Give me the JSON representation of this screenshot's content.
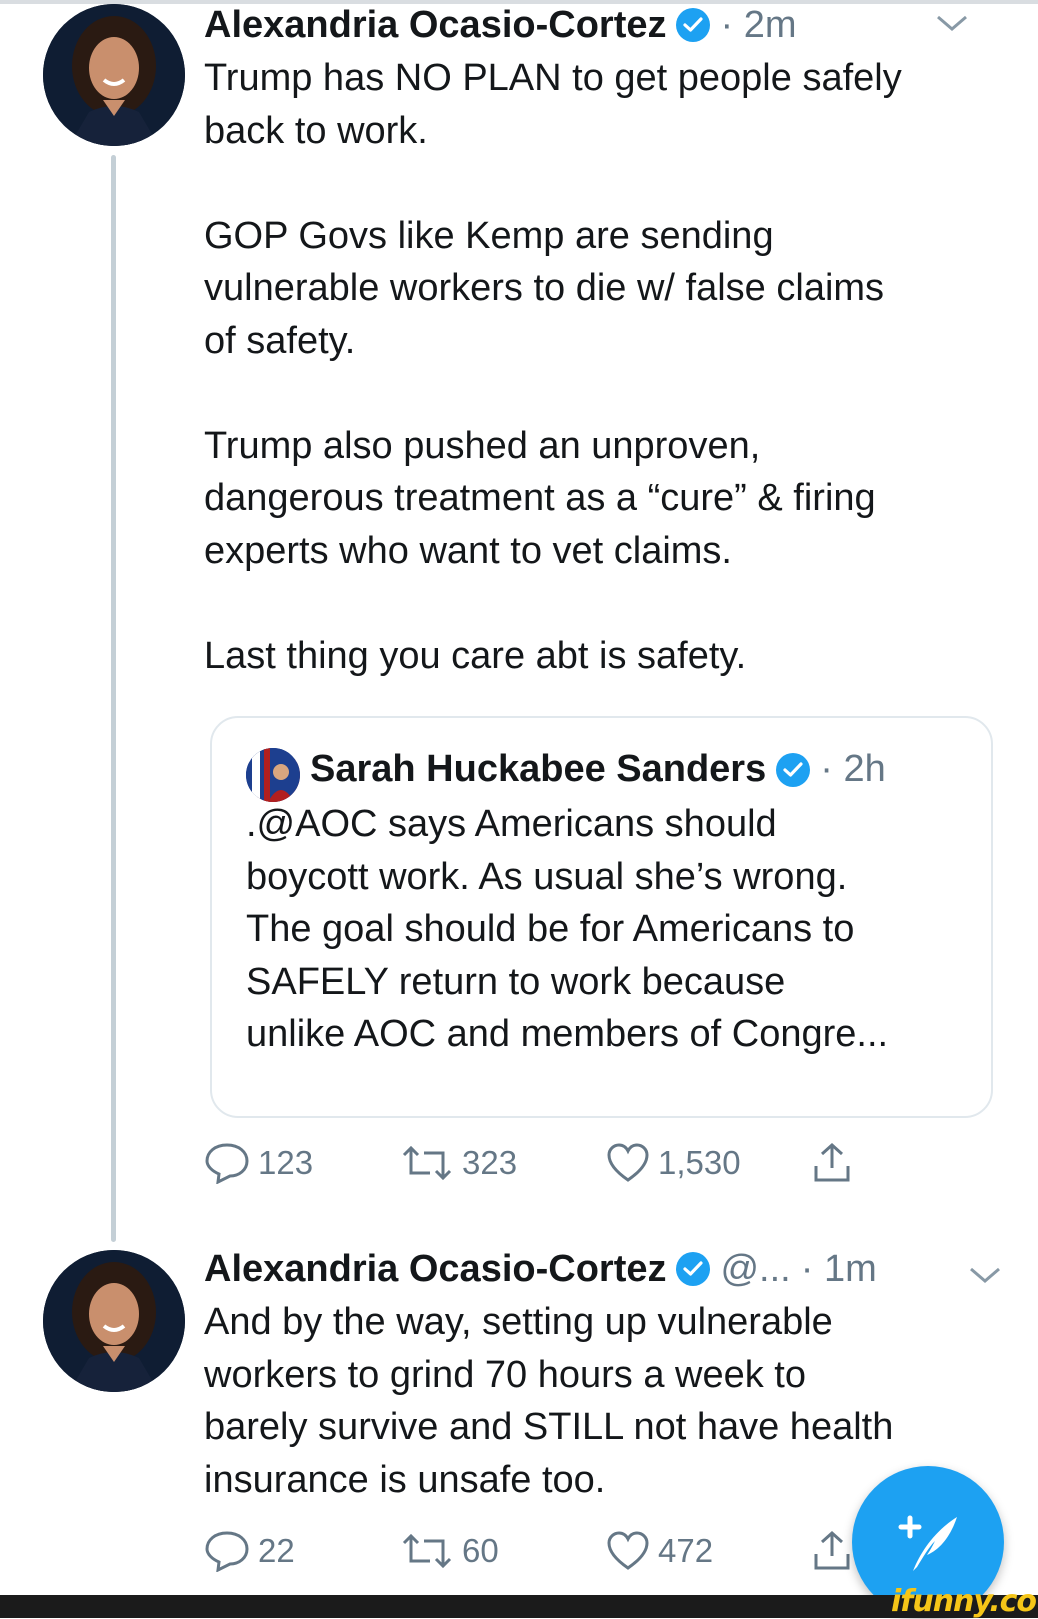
{
  "colors": {
    "accent": "#1da1f2",
    "text": "#14171a",
    "muted": "#657786",
    "thread": "#c4cfd6"
  },
  "tweet1": {
    "author": "Alexandria Ocasio-Cortez",
    "time": "· 2m",
    "text": "Trump has NO PLAN to get people safely\nback to work.\n\nGOP Govs like Kemp are sending\nvulnerable workers to die w/ false claims\nof safety.\n\nTrump also pushed an unproven,\ndangerous treatment as a “cure” & firing\nexperts who want to vet claims.\n\nLast thing you care abt is safety.",
    "quote": {
      "author": "Sarah Huckabee Sanders",
      "time": "· 2h",
      "text": ".@AOC says Americans should\nboycott work. As usual she’s wrong.\nThe goal should be for Americans to\nSAFELY return to work because\nunlike AOC and members of Congre..."
    },
    "replies": "123",
    "retweets": "323",
    "likes": "1,530"
  },
  "tweet2": {
    "author": "Alexandria Ocasio-Cortez",
    "handle": "@...",
    "time": "· 1m",
    "text": "And by the way, setting up vulnerable\nworkers to grind 70 hours a week to\nbarely survive and STILL not have health\ninsurance is unsafe too.",
    "replies": "22",
    "retweets": "60",
    "likes": "472"
  },
  "fab_icon": "compose-tweet-icon",
  "watermark": "ifunny.co"
}
